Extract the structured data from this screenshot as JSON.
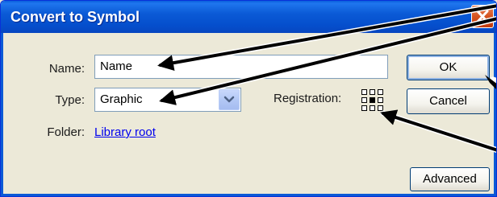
{
  "dialog": {
    "title": "Convert to Symbol",
    "close_icon": "close-icon"
  },
  "form": {
    "name_label": "Name:",
    "name_value": "Name",
    "type_label": "Type:",
    "type_value": "Graphic",
    "registration_label": "Registration:",
    "folder_label": "Folder:",
    "folder_link": "Library root"
  },
  "buttons": {
    "ok": "OK",
    "cancel": "Cancel",
    "advanced": "Advanced"
  },
  "colors": {
    "titlebar": "#0b5ad6",
    "close_button": "#d5531f",
    "dialog_background": "#ece9d8",
    "link": "#0000ee",
    "annotation_arrows": "#000000"
  }
}
